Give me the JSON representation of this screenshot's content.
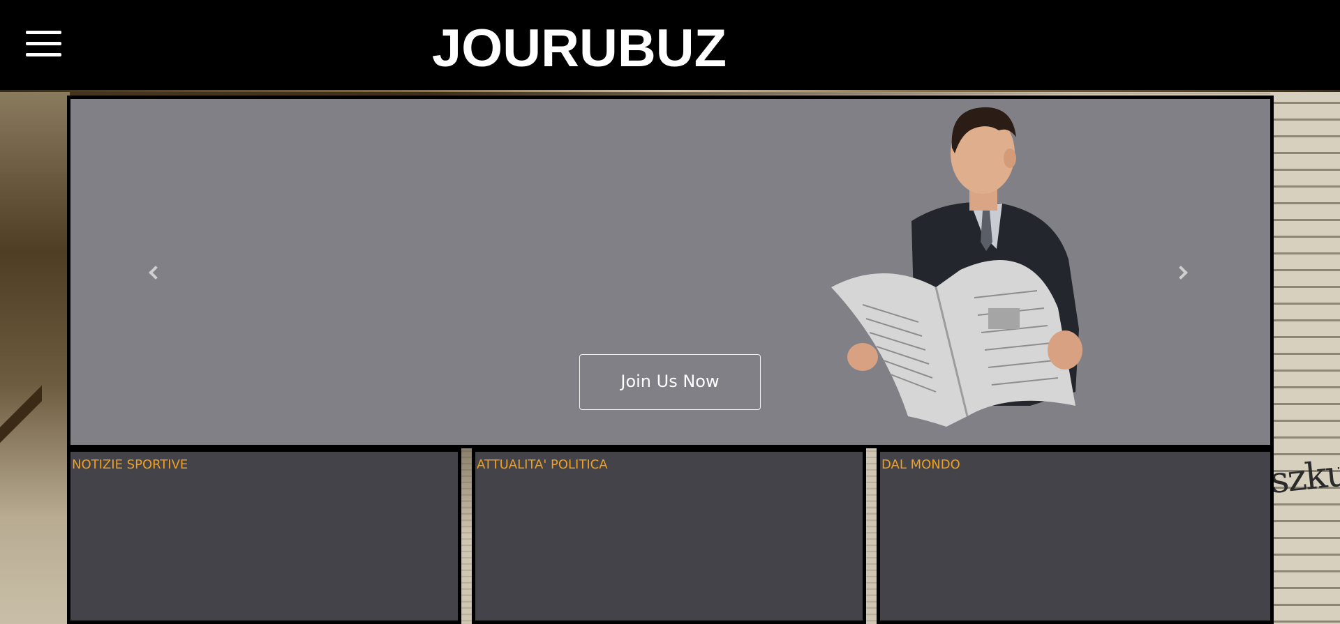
{
  "header": {
    "brand": "JOURUBUZ",
    "menu_icon": "hamburger-menu-icon"
  },
  "carousel": {
    "prev_icon": "chevron-left-icon",
    "next_icon": "chevron-right-icon",
    "cta_label": "Join Us Now"
  },
  "categories": [
    {
      "title": "NOTIZIE SPORTIVE"
    },
    {
      "title": "ATTUALITA' POLITICA"
    },
    {
      "title": "DAL MONDO"
    }
  ],
  "background": {
    "right_fragment": "szku"
  },
  "colors": {
    "header_bg": "#000000",
    "slide_bg": "#818086",
    "card_bg": "#444349",
    "card_title": "#f0a020"
  }
}
